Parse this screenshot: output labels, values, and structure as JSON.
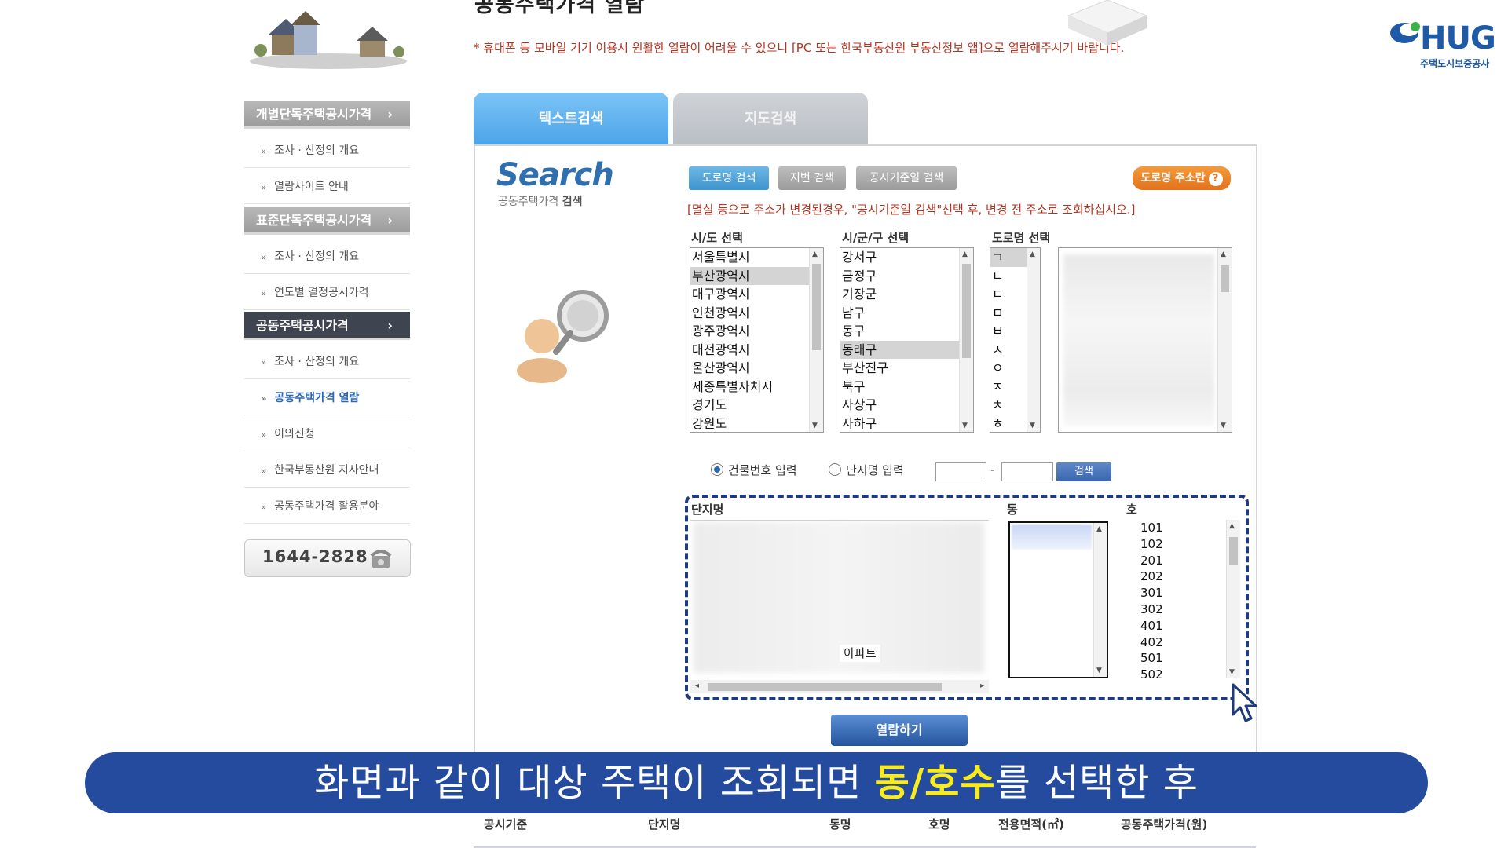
{
  "page": {
    "title": "공동주택가격 열람",
    "notice": "* 휴대폰 등 모바일 기기 이용시 원활한 열람이 어려울 수 있으니 [PC 또는 한국부동산원 부동산정보 앱]으로 열람해주시기 바랍니다."
  },
  "brand": {
    "logo_text": "HUG",
    "logo_sub": "주택도시보증공사",
    "accent": "#1f5aa6"
  },
  "sidebar": {
    "sections": [
      {
        "label": "개별단독주택공시가격",
        "arrow": "›"
      },
      {
        "label": "표준단독주택공시가격",
        "arrow": "›"
      },
      {
        "label": "공동주택공시가격",
        "arrow": "›"
      }
    ],
    "sub_items": [
      {
        "label": "조사 · 산정의 개요",
        "bullet": "»"
      },
      {
        "label": "열람사이트 안내",
        "bullet": "»"
      },
      {
        "label": "조사 · 산정의 개요",
        "bullet": "»"
      },
      {
        "label": "연도별 결정공시가격",
        "bullet": "»"
      },
      {
        "label": "조사 · 산정의 개요",
        "bullet": "»"
      },
      {
        "label": "공동주택가격 열람",
        "bullet": "»"
      },
      {
        "label": "이의신청",
        "bullet": "»"
      },
      {
        "label": "한국부동산원 지사안내",
        "bullet": "»"
      },
      {
        "label": "공동주택가격 활용분야",
        "bullet": "»"
      }
    ],
    "phone": "1644-2828"
  },
  "tabs": [
    {
      "label": "텍스트검색"
    },
    {
      "label": "지도검색"
    }
  ],
  "search": {
    "heading": "Search",
    "sub_normal": "공동주택가격 ",
    "sub_bold": "검색",
    "buttons": {
      "road": "도로명 검색",
      "lot": "지번 검색",
      "date": "공시기준일 검색",
      "road_info": "도로명 주소란",
      "road_info_icon": "?"
    },
    "red_notice": "[멸실 등으로 주소가 변경된경우, \"공시기준일 검색\"선택 후, 변경 전 주소로 조회하십시오.]",
    "labels": {
      "sido": "시/도 선택",
      "sigungu": "시/군/구 선택",
      "road": "도로명 선택"
    },
    "sido_list": [
      "서울특별시",
      "부산광역시",
      "대구광역시",
      "인천광역시",
      "광주광역시",
      "대전광역시",
      "울산광역시",
      "세종특별자치시",
      "경기도",
      "강원도"
    ],
    "sido_selected": "부산광역시",
    "sigungu_list": [
      "강서구",
      "금정구",
      "기장군",
      "남구",
      "동구",
      "동래구",
      "부산진구",
      "북구",
      "사상구",
      "사하구"
    ],
    "sigungu_selected": "동래구",
    "road_initials": [
      "ㄱ",
      "ㄴ",
      "ㄷ",
      "ㅁ",
      "ㅂ",
      "ㅅ",
      "ㅇ",
      "ㅈ",
      "ㅊ",
      "ㅎ"
    ],
    "road_initial_selected": "ㄱ",
    "radio_building": "건물번호 입력",
    "radio_complex": "단지명 입력",
    "radio_selected": "건물번호 입력",
    "number_dash": "-",
    "find_button": "검색",
    "col_complex": "단지명",
    "col_dong": "동",
    "col_ho": "호",
    "complex_visible": "아파트",
    "ho_list": [
      "101",
      "102",
      "201",
      "202",
      "301",
      "302",
      "401",
      "402",
      "501",
      "502"
    ],
    "view_button": "열람하기"
  },
  "caption": {
    "before": "화면과 같이 대상 주택이 조회되면 ",
    "highlight": "동/호수",
    "after": "를 선택한 후",
    "bg": "#244b9e",
    "highlight_color": "#f8ec1e"
  },
  "result_table": {
    "headers": [
      "공시기준",
      "단지명",
      "동명",
      "호명",
      "전용면적(㎡)",
      "공동주택가격(원)"
    ]
  }
}
